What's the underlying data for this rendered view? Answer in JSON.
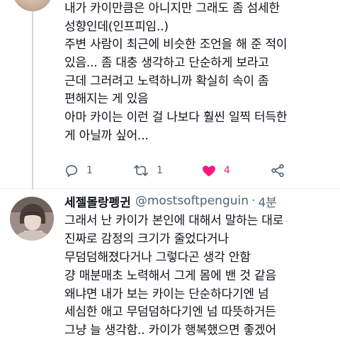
{
  "tweet1": {
    "lines": [
      "내가 카이만큼은 아니지만 그래도 좀 섬세한",
      "성향인데(인프피임..)",
      "주변 사람이 최근에 비슷한 조언을 해 준 적이",
      "있음... 좀 대충 생각하고 단순하게 보라고",
      "근데 그러려고 노력하니까 확실히 속이 좀",
      "편해지는 게 있음",
      "아마 카이는 이런 걸 나보다 훨씬 일찍 터득한",
      "게 아닐까 싶어..."
    ],
    "actions": {
      "reply_count": "1",
      "retweet_count": "1",
      "like_count": "4"
    }
  },
  "tweet2": {
    "display_name": "세젤몰랑펭귄",
    "handle": "@mostsoftpenguin",
    "separator": "·",
    "time": "4분",
    "lines": [
      "그래서 난 카이가 본인에 대해서 말하는 대로",
      "진짜로 감정의 크기가 줄었다거나",
      "무덤덤해졌다거나 그렇다곤 생각 안함",
      "걍 매분매초 노력해서 그게 몸에 밴 것 같음",
      "왜냐면 내가 보는 카이는 단순하다기엔 넘",
      "세심한 애고 무덤덤하다기엔 넘 따뜻하거든",
      "그냥 늘 생각함.. 카이가 행복했으면 좋겠어"
    ]
  },
  "colors": {
    "text": "#0f1419",
    "secondary": "#536471",
    "like": "#f91880",
    "thread_line": "#cfd9de"
  },
  "icons": [
    "reply-icon",
    "retweet-icon",
    "like-icon",
    "share-icon"
  ]
}
